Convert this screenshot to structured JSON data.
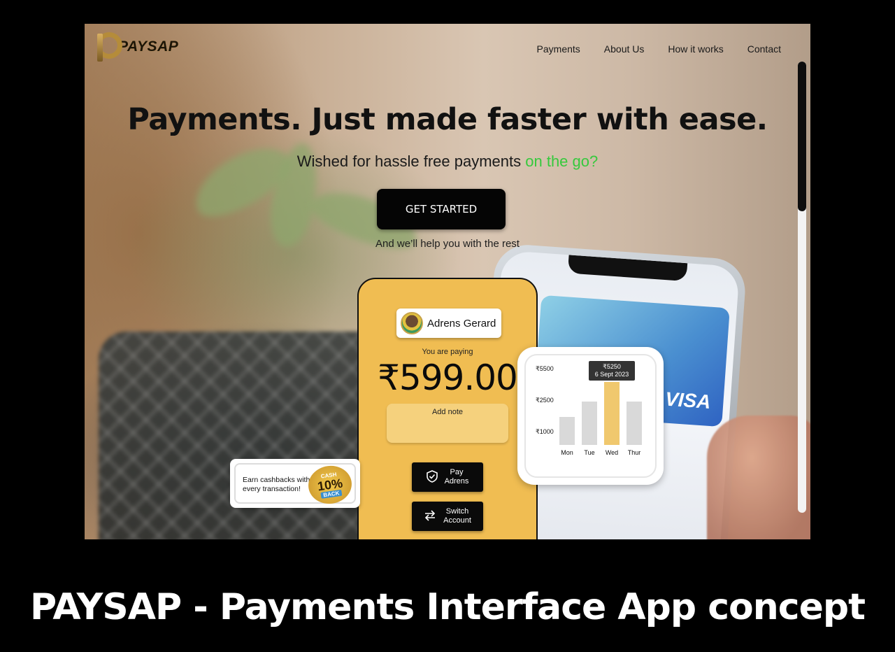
{
  "brand": {
    "name": "PAYSAP"
  },
  "nav": {
    "items": [
      {
        "label": "Payments"
      },
      {
        "label": "About Us"
      },
      {
        "label": "How it works"
      },
      {
        "label": "Contact"
      }
    ]
  },
  "hero": {
    "title": "Payments. Just made faster with ease.",
    "subtitle_main": "Wished for hassle free payments",
    "subtitle_accent": "on the go?",
    "cta_label": "GET STARTED",
    "cta_note": "And we’ll help you with the rest"
  },
  "mock_app": {
    "user_name": "Adrens Gerard",
    "paying_label": "You are paying",
    "amount": "₹599.00",
    "note_label": "Add note",
    "pay_line1": "Pay",
    "pay_line2": "Adrens",
    "switch_line1": "Switch",
    "switch_line2": "Account"
  },
  "cashback": {
    "text": "Earn cashbacks with every transaction!",
    "badge_top": "CASH",
    "badge_value": "10%",
    "badge_bottom": "BACK"
  },
  "chart_data": {
    "type": "bar",
    "categories": [
      "Mon",
      "Tue",
      "Wed",
      "Thur"
    ],
    "values": [
      1500,
      2500,
      5250,
      2500
    ],
    "y_ticks": [
      {
        "label": "₹5500",
        "value": 5500
      },
      {
        "label": "₹2500",
        "value": 2500
      },
      {
        "label": "₹1000",
        "value": 1000
      }
    ],
    "highlight_index": 2,
    "tooltip": {
      "value": "₹5250",
      "date": "6 Sept 2023"
    },
    "colors": {
      "bar": "#d9d9d9",
      "highlight": "#f0c86e",
      "tooltip_bg": "#333333"
    }
  },
  "phone_card": {
    "brand": "VISA"
  },
  "colors": {
    "accent_green": "#36c93d",
    "app_yellow": "#f0bd52"
  },
  "caption": "PAYSAP - Payments Interface App concept"
}
